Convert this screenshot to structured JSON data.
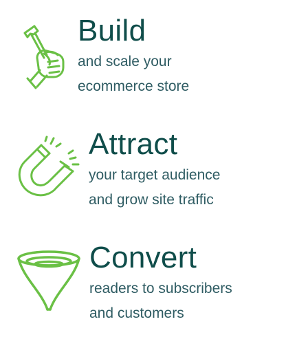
{
  "colors": {
    "heading": "#0f4d4a",
    "body": "#2f5c63",
    "icon": "#6ac045"
  },
  "features": [
    {
      "icon": "hammer-in-hand-icon",
      "title": "Build",
      "lines": [
        "and scale your",
        "ecommerce store"
      ]
    },
    {
      "icon": "magnet-icon",
      "title": "Attract",
      "lines": [
        "your target audience",
        "and grow site traffic"
      ]
    },
    {
      "icon": "funnel-icon",
      "title": "Convert",
      "lines": [
        "readers to subscribers",
        "and customers"
      ]
    }
  ]
}
